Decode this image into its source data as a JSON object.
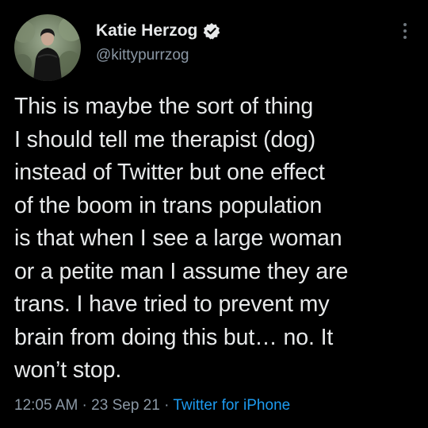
{
  "author": {
    "display_name": "Katie Herzog",
    "handle": "@kittypurrzog",
    "verified": true,
    "avatar_icon": "avatar-photo"
  },
  "tweet": {
    "text": "This is maybe the sort of thing\nI should tell me therapist (dog)\ninstead of Twitter but one effect\nof the boom in trans population\nis that when I see a large woman\nor a petite man I assume they are\ntrans. I have tried to prevent my\nbrain from doing this but… no. It\nwon’t stop."
  },
  "meta": {
    "time": "12:05 AM",
    "separator_1": " · ",
    "date": "23 Sep 21",
    "separator_2": " · ",
    "source": "Twitter for iPhone"
  },
  "colors": {
    "background": "#000000",
    "text": "#e7e9ea",
    "muted": "#8b98a5",
    "accent": "#1d9bf0"
  },
  "icons": {
    "verified": "verified-badge-icon",
    "more": "more-vertical-icon"
  }
}
